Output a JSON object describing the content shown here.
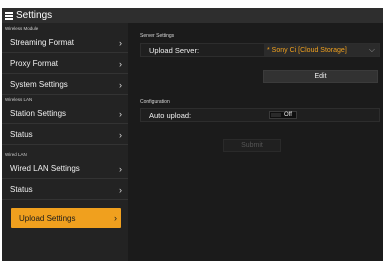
{
  "window": {
    "title": "Settings"
  },
  "sidebar": {
    "groups": [
      {
        "label": "Wireless Module",
        "items": [
          {
            "label": "Streaming Format"
          },
          {
            "label": "Proxy Format"
          },
          {
            "label": "System Settings"
          }
        ]
      },
      {
        "label": "Wireless LAN",
        "items": [
          {
            "label": "Station Settings"
          },
          {
            "label": "Status"
          }
        ]
      },
      {
        "label": "Wired LAN",
        "items": [
          {
            "label": "Wired LAN Settings"
          },
          {
            "label": "Status"
          }
        ]
      }
    ],
    "active_item": {
      "label": "Upload Settings"
    },
    "chevron": "›"
  },
  "main": {
    "server_settings": {
      "section_label": "Server Settings",
      "upload_server_label": "Upload Server:",
      "upload_server_value": "* Sony Ci [Cloud Storage]",
      "caret": "⌵",
      "edit_label": "Edit"
    },
    "configuration": {
      "section_label": "Configuration",
      "auto_upload_label": "Auto upload:",
      "auto_upload_state": "Off"
    },
    "submit_label": "Submit"
  },
  "colors": {
    "accent": "#f0a01e",
    "background": "#1b1b1b",
    "sidebar": "#232323",
    "disabled_text": "#555555"
  },
  "icons": {
    "menu": "hamburger-menu-icon",
    "chevron": "chevron-right-icon",
    "dropdown": "chevron-down-icon"
  }
}
